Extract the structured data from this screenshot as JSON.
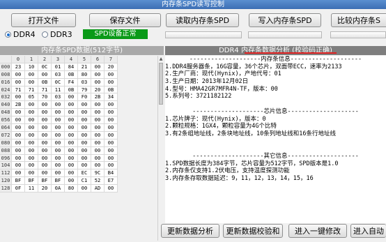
{
  "window": {
    "title": "内存条SPD读写控制"
  },
  "toolbar": {
    "open_file": "打开文件",
    "save_file": "保存文件",
    "read_spd": "读取内存条SPD",
    "write_spd": "写入内存条SPD",
    "compare_spd": "比较内存条S"
  },
  "mode": {
    "ddr4": "DDR4",
    "ddr3": "DDR3",
    "selected": "DDR4",
    "status": "SPD设备正常"
  },
  "left_panel": {
    "title": "内存条SPD数据(512字节)",
    "columns": [
      "0",
      "1",
      "2",
      "3",
      "4",
      "5",
      "6",
      "7"
    ],
    "rows": [
      {
        "addr": "000",
        "cells": [
          "23",
          "10",
          "0C",
          "01",
          "84",
          "21",
          "00",
          "20"
        ]
      },
      {
        "addr": "008",
        "cells": [
          "00",
          "00",
          "00",
          "03",
          "0B",
          "80",
          "00",
          "00"
        ]
      },
      {
        "addr": "016",
        "cells": [
          "00",
          "00",
          "0B",
          "0C",
          "F4",
          "03",
          "00",
          "00"
        ]
      },
      {
        "addr": "024",
        "cells": [
          "71",
          "71",
          "71",
          "11",
          "0B",
          "79",
          "20",
          "0B"
        ]
      },
      {
        "addr": "032",
        "cells": [
          "00",
          "05",
          "70",
          "03",
          "00",
          "F0",
          "2B",
          "34"
        ]
      },
      {
        "addr": "040",
        "cells": [
          "2B",
          "00",
          "00",
          "00",
          "00",
          "00",
          "00",
          "00"
        ]
      },
      {
        "addr": "048",
        "cells": [
          "00",
          "00",
          "00",
          "00",
          "00",
          "00",
          "00",
          "00"
        ]
      },
      {
        "addr": "056",
        "cells": [
          "00",
          "00",
          "00",
          "00",
          "00",
          "00",
          "00",
          "00"
        ]
      },
      {
        "addr": "064",
        "cells": [
          "00",
          "00",
          "00",
          "00",
          "00",
          "00",
          "00",
          "00"
        ]
      },
      {
        "addr": "072",
        "cells": [
          "00",
          "00",
          "00",
          "00",
          "00",
          "00",
          "00",
          "00"
        ]
      },
      {
        "addr": "080",
        "cells": [
          "00",
          "00",
          "00",
          "00",
          "00",
          "00",
          "00",
          "00"
        ]
      },
      {
        "addr": "088",
        "cells": [
          "00",
          "00",
          "00",
          "00",
          "00",
          "00",
          "00",
          "00"
        ]
      },
      {
        "addr": "096",
        "cells": [
          "00",
          "00",
          "00",
          "00",
          "00",
          "00",
          "00",
          "00"
        ]
      },
      {
        "addr": "104",
        "cells": [
          "00",
          "00",
          "00",
          "00",
          "00",
          "00",
          "00",
          "00"
        ]
      },
      {
        "addr": "112",
        "cells": [
          "00",
          "00",
          "00",
          "00",
          "00",
          "EC",
          "9C",
          "B4"
        ]
      },
      {
        "addr": "120",
        "cells": [
          "BF",
          "BF",
          "BF",
          "BF",
          "00",
          "C1",
          "52",
          "E7"
        ]
      },
      {
        "addr": "128",
        "cells": [
          "0F",
          "11",
          "20",
          "0A",
          "80",
          "00",
          "AD",
          "00"
        ]
      }
    ]
  },
  "right_panel": {
    "title": "DDR4 内存条数据分析 (校验码正确)",
    "lines": [
      {
        "kind": "sec",
        "text": "--------------------内存条信息--------------------"
      },
      {
        "kind": "txt",
        "text": "1.DDR4服务器条，16G容量，36个芯片，双面带ECC，速率为2133"
      },
      {
        "kind": "txt",
        "text": "2.生产厂商：现代(Hynix)，产地代号：01"
      },
      {
        "kind": "txt",
        "text": "3.生产日期：2013年12月02日"
      },
      {
        "kind": "txt",
        "text": "4.型号：HMA42GR7MFR4N-TF，版本：00"
      },
      {
        "kind": "txt",
        "text": "5.系列号：3721182122"
      },
      {
        "kind": "blank",
        "text": ""
      },
      {
        "kind": "sec",
        "text": "--------------------芯片信息--------------------"
      },
      {
        "kind": "txt",
        "text": "1.芯片牌子：现代(Hynix)，版本：0"
      },
      {
        "kind": "txt",
        "text": "2.颗粒规格：1GX4，颗粒容量为4G个比特"
      },
      {
        "kind": "txt",
        "text": "3.有2条组地址线，2条块地址线，10条列地址线和16条行地址线"
      },
      {
        "kind": "blank",
        "text": ""
      },
      {
        "kind": "blank",
        "text": ""
      },
      {
        "kind": "sec",
        "text": "--------------------其它信息--------------------"
      },
      {
        "kind": "txt",
        "text": "1.SPD数据长度为384字节，芯片容量为512字节，SPD版本是1.0"
      },
      {
        "kind": "txt",
        "text": "2.内存条仅支持1.2伏电压，支持温度探测功能"
      },
      {
        "kind": "txt",
        "text": "3.内存条存取数据延迟：9，11，12，13，14，15，16"
      }
    ]
  },
  "bottom_buttons": {
    "update_analysis": "更新数据分析",
    "update_checksum": "更新数据校验和",
    "one_click_modify": "进入一键修改",
    "auto_enter": "进入自动"
  }
}
